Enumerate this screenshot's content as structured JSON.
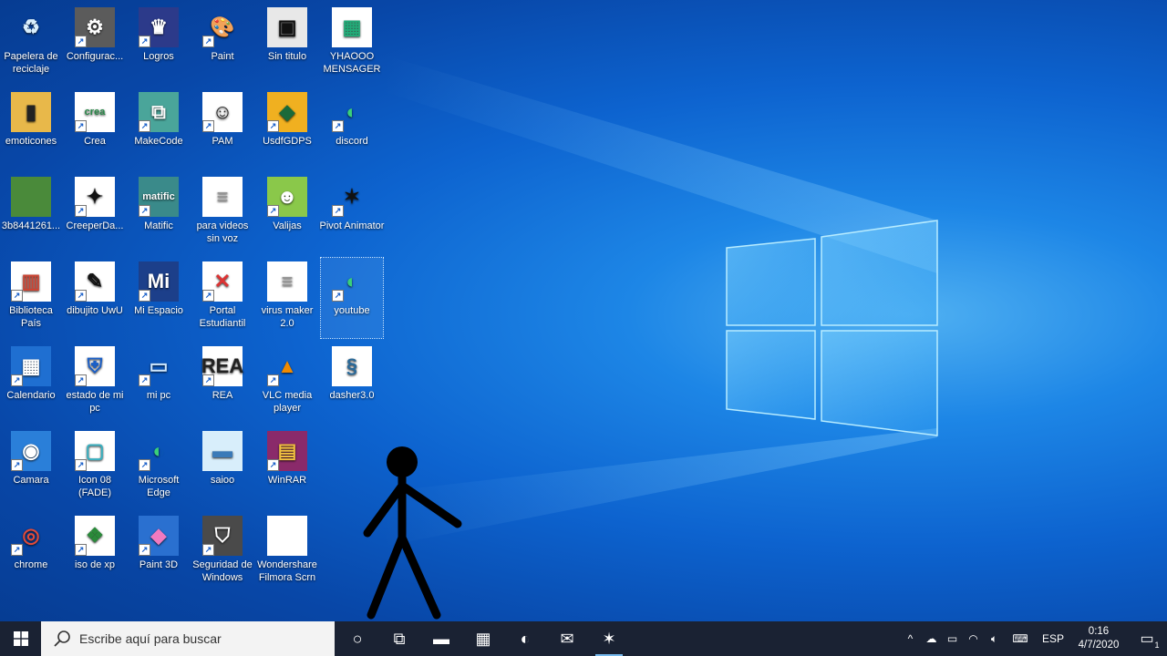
{
  "desktop_icons": [
    {
      "label": "Papelera de reciclaje",
      "icon": "recycle-bin-icon",
      "sym": "♻",
      "bg": "transparent",
      "fg": "#d9eefc",
      "shortcut": false
    },
    {
      "label": "Configurac...",
      "icon": "settings-gear-icon",
      "sym": "⚙",
      "bg": "#5b5b5b",
      "fg": "#ffffff",
      "shortcut": true
    },
    {
      "label": "Logros",
      "icon": "logros-icon",
      "sym": "♛",
      "bg": "#2c3a8a",
      "fg": "#ffffff",
      "shortcut": true
    },
    {
      "label": "Paint",
      "icon": "paint-palette-icon",
      "sym": "🎨",
      "bg": "transparent",
      "fg": "#ffffff",
      "shortcut": true
    },
    {
      "label": "Sin titulo",
      "icon": "sin-titulo-icon",
      "sym": "▣",
      "bg": "#e8e8e8",
      "fg": "#111",
      "shortcut": false
    },
    {
      "label": "YHAOOO MENSAGER",
      "icon": "yahoo-messenger-icon",
      "sym": "▦",
      "bg": "#ffffff",
      "fg": "#2a7",
      "shortcut": false
    },
    {
      "label": "emoticones",
      "icon": "folder-icon",
      "sym": "▮",
      "bg": "#e8b84a",
      "fg": "#222",
      "shortcut": false
    },
    {
      "label": "Crea",
      "icon": "crea-icon",
      "sym": "crea",
      "bg": "#ffffff",
      "fg": "#2a8a4a",
      "shortcut": true
    },
    {
      "label": "MakeCode",
      "icon": "makecode-icon",
      "sym": "⧉",
      "bg": "#4aa59a",
      "fg": "#ffffff",
      "shortcut": true
    },
    {
      "label": "PAM",
      "icon": "pam-face-icon",
      "sym": "☺",
      "bg": "#ffffff",
      "fg": "#222",
      "shortcut": true
    },
    {
      "label": "UsdfGDPS",
      "icon": "geometry-dash-icon",
      "sym": "◆",
      "bg": "#f0b020",
      "fg": "#1a6a3a",
      "shortcut": true
    },
    {
      "label": "discord",
      "icon": "edge-browser-icon",
      "sym": "◐",
      "bg": "transparent",
      "fg": "#3ad07a",
      "shortcut": true
    },
    {
      "label": "3b8441261...",
      "icon": "landscape-image-icon",
      "sym": "",
      "bg": "#4a8a3a",
      "fg": "#fff",
      "shortcut": false
    },
    {
      "label": "CreeperDa...",
      "icon": "creeper-icon",
      "sym": "✦",
      "bg": "#ffffff",
      "fg": "#111",
      "shortcut": true
    },
    {
      "label": "Matific",
      "icon": "matific-icon",
      "sym": "matific",
      "bg": "#3a8a8a",
      "fg": "#ffffff",
      "shortcut": true
    },
    {
      "label": "para videos sin voz",
      "icon": "text-file-icon",
      "sym": "≡",
      "bg": "#ffffff",
      "fg": "#999",
      "shortcut": false
    },
    {
      "label": "Valijas",
      "icon": "valijas-icon",
      "sym": "☻",
      "bg": "#8ac84a",
      "fg": "#ffffff",
      "shortcut": true
    },
    {
      "label": "Pivot Animator",
      "icon": "pivot-animator-icon",
      "sym": "✶",
      "bg": "transparent",
      "fg": "#111",
      "shortcut": true
    },
    {
      "label": "Biblioteca País",
      "icon": "books-icon",
      "sym": "▥",
      "bg": "#ffffff",
      "fg": "#c43",
      "shortcut": true
    },
    {
      "label": "dibujito UwU",
      "icon": "drawing-icon",
      "sym": "✎",
      "bg": "#ffffff",
      "fg": "#111",
      "shortcut": true
    },
    {
      "label": "Mi Espacio",
      "icon": "mi-espacio-icon",
      "sym": "Mi",
      "bg": "#1c3f8a",
      "fg": "#ffffff",
      "shortcut": true
    },
    {
      "label": "Portal Estudiantil",
      "icon": "portal-estudiantil-icon",
      "sym": "✕",
      "bg": "#ffffff",
      "fg": "#d33",
      "shortcut": true
    },
    {
      "label": "virus maker 2.0",
      "icon": "text-file-icon",
      "sym": "≡",
      "bg": "#ffffff",
      "fg": "#999",
      "shortcut": false
    },
    {
      "label": "youtube",
      "icon": "edge-browser-icon",
      "sym": "◐",
      "bg": "transparent",
      "fg": "#3ad07a",
      "shortcut": true,
      "selected": true
    },
    {
      "label": "Calendario",
      "icon": "calendar-icon",
      "sym": "▦",
      "bg": "#1f6fd1",
      "fg": "#ffffff",
      "shortcut": true
    },
    {
      "label": "estado de mi pc",
      "icon": "pc-status-icon",
      "sym": "⛨",
      "bg": "#ffffff",
      "fg": "#1a5fc8",
      "shortcut": true
    },
    {
      "label": "mi pc",
      "icon": "computer-icon",
      "sym": "▭",
      "bg": "transparent",
      "fg": "#cfe8ff",
      "shortcut": true
    },
    {
      "label": "REA",
      "icon": "rea-icon",
      "sym": "REA",
      "bg": "#ffffff",
      "fg": "#222",
      "shortcut": true
    },
    {
      "label": "VLC media player",
      "icon": "vlc-cone-icon",
      "sym": "▲",
      "bg": "transparent",
      "fg": "#f08a00",
      "shortcut": true
    },
    {
      "label": "dasher3.0",
      "icon": "dasher-icon",
      "sym": "§",
      "bg": "#ffffff",
      "fg": "#2a6a9a",
      "shortcut": false
    },
    {
      "label": "Camara",
      "icon": "camera-icon",
      "sym": "◉",
      "bg": "#2a7fd9",
      "fg": "#ffffff",
      "shortcut": true
    },
    {
      "label": "Icon 08 (FADE)",
      "icon": "fade-icon",
      "sym": "▢",
      "bg": "#ffffff",
      "fg": "#3ab0c0",
      "shortcut": true
    },
    {
      "label": "Microsoft Edge",
      "icon": "edge-browser-icon",
      "sym": "◐",
      "bg": "transparent",
      "fg": "#3ad07a",
      "shortcut": true
    },
    {
      "label": "saioo",
      "icon": "saioo-icon",
      "sym": "▬",
      "bg": "#d8eefb",
      "fg": "#3a7ab8",
      "shortcut": false
    },
    {
      "label": "WinRAR",
      "icon": "winrar-icon",
      "sym": "▤",
      "bg": "#8a2a6a",
      "fg": "#f0c040",
      "shortcut": true
    },
    {
      "label": "",
      "icon": "",
      "sym": "",
      "bg": "transparent",
      "fg": "#fff",
      "shortcut": false,
      "empty": true
    },
    {
      "label": "chrome",
      "icon": "chrome-icon",
      "sym": "◎",
      "bg": "transparent",
      "fg": "#e04a3a",
      "shortcut": true
    },
    {
      "label": "iso de xp",
      "icon": "windows-xp-icon",
      "sym": "❖",
      "bg": "#ffffff",
      "fg": "#2a8a3a",
      "shortcut": true
    },
    {
      "label": "Paint 3D",
      "icon": "paint-3d-icon",
      "sym": "◆",
      "bg": "#2a70d0",
      "fg": "#f07ac0",
      "shortcut": true
    },
    {
      "label": "Seguridad de Windows",
      "icon": "shield-icon",
      "sym": "⛉",
      "bg": "#4a4a4a",
      "fg": "#ffffff",
      "shortcut": true
    },
    {
      "label": "Wondershare Filmora Scrn",
      "icon": "blank-file-icon",
      "sym": "",
      "bg": "#ffffff",
      "fg": "#999",
      "shortcut": false
    }
  ],
  "taskbar": {
    "search_placeholder": "Escribe aquí para buscar",
    "apps": [
      {
        "name": "cortana-icon",
        "sym": "○"
      },
      {
        "name": "task-view-icon",
        "sym": "⧉"
      },
      {
        "name": "file-explorer-icon",
        "sym": "▬"
      },
      {
        "name": "microsoft-store-icon",
        "sym": "▦"
      },
      {
        "name": "edge-taskbar-icon",
        "sym": "◐"
      },
      {
        "name": "mail-icon",
        "sym": "✉"
      },
      {
        "name": "pivot-animator-taskbar-icon",
        "sym": "✶",
        "active": true
      }
    ],
    "tray": {
      "chevron": "^",
      "language": "ESP",
      "time": "0:16",
      "date": "4/7/2020",
      "notifications": "1"
    }
  },
  "colors": {
    "taskbar": "#1a2233",
    "accent": "#76b9ed"
  }
}
